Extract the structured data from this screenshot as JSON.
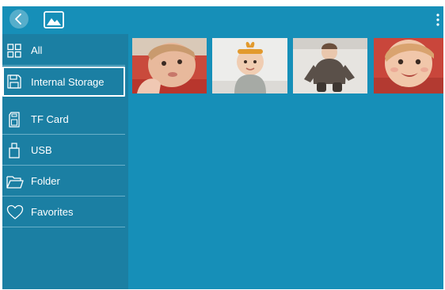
{
  "topbar": {
    "back_icon": "chevron-left-icon",
    "gallery_icon": "image-icon",
    "menu_icon": "more-vertical-icon"
  },
  "sidebar": {
    "items": [
      {
        "label": "All",
        "icon": "grid-icon",
        "active": false
      },
      {
        "label": "Internal Storage",
        "icon": "save-icon",
        "active": true
      },
      {
        "label": "TF Card",
        "icon": "sd-card-icon",
        "active": false
      },
      {
        "label": "USB",
        "icon": "usb-icon",
        "active": false
      },
      {
        "label": "Folder",
        "icon": "folder-icon",
        "active": false
      },
      {
        "label": "Favorites",
        "icon": "heart-icon",
        "active": false
      }
    ]
  },
  "gallery": {
    "photos": [
      {
        "subject": "baby-closeup"
      },
      {
        "subject": "baby-headband"
      },
      {
        "subject": "baby-jacket"
      },
      {
        "subject": "baby-smiling"
      }
    ]
  },
  "colors": {
    "background": "#168fb8",
    "sidebar": "#1b7fa3",
    "text": "#ffffff"
  }
}
